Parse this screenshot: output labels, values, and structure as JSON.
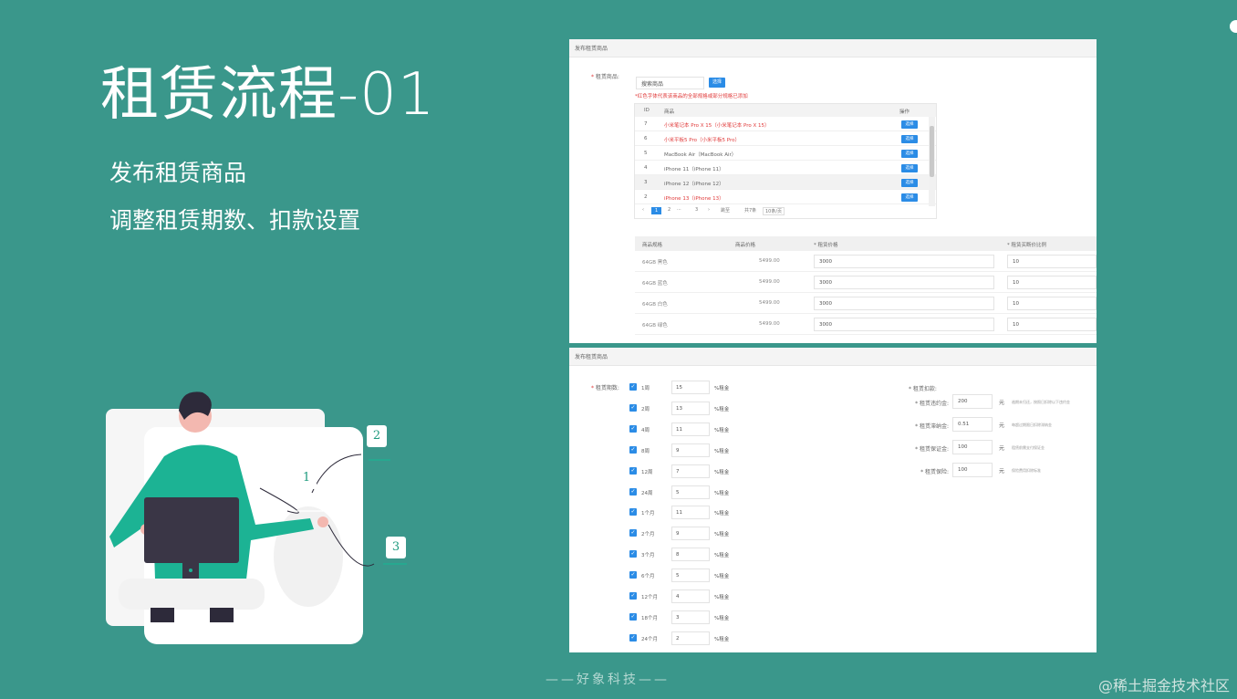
{
  "slide": {
    "title": "租赁流程-01",
    "bullets": [
      "发布租赁商品",
      "调整租赁期数、扣款设置"
    ],
    "footer": "——好象科技——",
    "watermark": "@稀土掘金技术社区"
  },
  "illustration": {
    "steps": [
      "1",
      "2",
      "3"
    ]
  },
  "shot1": {
    "header": "发布租赁商品",
    "field_label": "租赁商品:",
    "search_placeholder": "搜索商品",
    "search_button": "选择",
    "note": "*红色字体代表该商品的全部规格或部分规格已添加",
    "list_columns": [
      "ID",
      "商品",
      "操作"
    ],
    "list_rows": [
      {
        "id": "7",
        "name": "小米笔记本 Pro X 15（小米笔记本 Pro X 15）",
        "action": "选择",
        "highlight": "red",
        "selected": false
      },
      {
        "id": "6",
        "name": "小米平板5 Pro（小米平板5 Pro）",
        "action": "选择",
        "highlight": "red",
        "selected": false
      },
      {
        "id": "5",
        "name": "MacBook Air（MacBook Air）",
        "action": "选择",
        "highlight": "none",
        "selected": false
      },
      {
        "id": "4",
        "name": "iPhone 11（iPhone 11）",
        "action": "选择",
        "highlight": "none",
        "selected": false
      },
      {
        "id": "3",
        "name": "iPhone 12（iPhone 12）",
        "action": "选择",
        "highlight": "none",
        "selected": true
      },
      {
        "id": "2",
        "name": "iPhone 13（iPhone 13）",
        "action": "选择",
        "highlight": "red",
        "selected": false
      }
    ],
    "pager": {
      "pages": [
        "1",
        "2",
        "3"
      ],
      "current": "1",
      "jump_label": "跳至",
      "confirm": "确定",
      "total": "共7条",
      "page_size": "10条/页"
    },
    "spec_columns": [
      "商品规格",
      "商品价格",
      "* 租赁价格",
      "* 租赁买断价比例"
    ],
    "spec_rows": [
      {
        "spec": "64GB 黑色",
        "price": "5499.00",
        "rent": "3000",
        "ratio": "10"
      },
      {
        "spec": "64GB 蓝色",
        "price": "5499.00",
        "rent": "3000",
        "ratio": "10"
      },
      {
        "spec": "64GB 白色",
        "price": "5499.00",
        "rent": "3000",
        "ratio": "10"
      },
      {
        "spec": "64GB 绿色",
        "price": "5499.00",
        "rent": "3000",
        "ratio": "10"
      }
    ]
  },
  "shot2": {
    "header": "发布租赁商品",
    "period_label": "租赁期数:",
    "periods": [
      {
        "name": "1周",
        "value": "15",
        "unit": "%租金",
        "checked": true
      },
      {
        "name": "2周",
        "value": "13",
        "unit": "%租金",
        "checked": true
      },
      {
        "name": "4周",
        "value": "11",
        "unit": "%租金",
        "checked": true
      },
      {
        "name": "8周",
        "value": "9",
        "unit": "%租金",
        "checked": true
      },
      {
        "name": "12周",
        "value": "7",
        "unit": "%租金",
        "checked": true
      },
      {
        "name": "24周",
        "value": "5",
        "unit": "%租金",
        "checked": true
      },
      {
        "name": "1个月",
        "value": "11",
        "unit": "%租金",
        "checked": true
      },
      {
        "name": "2个月",
        "value": "9",
        "unit": "%租金",
        "checked": true
      },
      {
        "name": "3个月",
        "value": "8",
        "unit": "%租金",
        "checked": true
      },
      {
        "name": "6个月",
        "value": "5",
        "unit": "%租金",
        "checked": true
      },
      {
        "name": "12个月",
        "value": "4",
        "unit": "%租金",
        "checked": true
      },
      {
        "name": "18个月",
        "value": "3",
        "unit": "%租金",
        "checked": true
      },
      {
        "name": "24个月",
        "value": "2",
        "unit": "%租金",
        "checked": true
      }
    ],
    "deposit_title": "* 租赁扣款:",
    "deposits": [
      {
        "label": "* 租赁违约金:",
        "value": "200",
        "unit": "元",
        "hint": "逾期未归还，按照日扣除以下违约金"
      },
      {
        "label": "* 租赁滞纳金:",
        "value": "0.51",
        "unit": "元",
        "hint": "每超过期限日扣除滞纳金"
      },
      {
        "label": "* 租赁保证金:",
        "value": "100",
        "unit": "元",
        "hint": "租赁前需支付保证金"
      },
      {
        "label": "* 租赁保险:",
        "value": "100",
        "unit": "元",
        "hint": "保险费用扣除标准"
      }
    ]
  },
  "colors": {
    "background": "#3a978b",
    "accent_blue": "#2b8ce6",
    "highlight_red": "#e03a3a",
    "illustration_green": "#1cb394"
  }
}
